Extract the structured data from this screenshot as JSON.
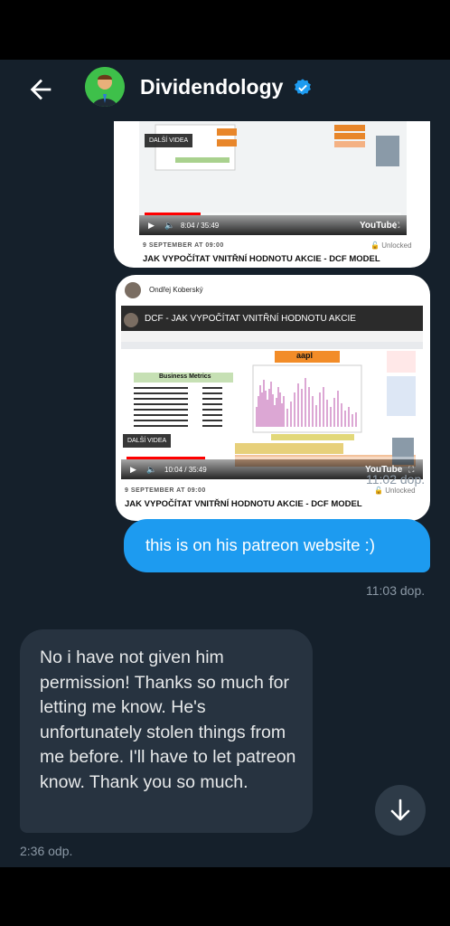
{
  "header": {
    "title": "Dividendology",
    "back_icon": "arrow-left-icon",
    "verified_icon": "verified-badge-icon"
  },
  "post_top": {
    "date": "9 SEPTEMBER AT 09:00",
    "unlocked": "Unlocked",
    "title": "JAK VYPOČÍTAT VNITŘNÍ HODNOTU AKCIE - DCF MODEL",
    "dalsi_videa": "DALŠÍ VIDEA",
    "time": "8:04 / 35:49",
    "youtube": "YouTube",
    "progress": 0.22
  },
  "post_main": {
    "author": "Ondřej Koberský",
    "video_title": "DCF - JAK VYPOČÍTAT VNITŘNÍ HODNOTU AKCIE",
    "ticker": "aapl",
    "table_title": "Business Metrics",
    "dalsi_videa": "DALŠÍ VIDEA",
    "time": "10:04 / 35:49",
    "youtube": "YouTube",
    "date": "9 SEPTEMBER AT 09:00",
    "unlocked": "Unlocked",
    "title": "JAK VYPOČÍTAT VNITŘNÍ HODNOTU AKCIE - DCF MODEL",
    "progress": 0.27
  },
  "messages": {
    "time1": "11:02 dop.",
    "outgoing": "this is on his patreon website :)",
    "time2": "11:03 dop.",
    "incoming": "No i have not given him permission! Thanks so much for letting me know. He's unfortunately stolen things from me before. I'll have to let patreon know. Thank you so much.",
    "time3": "2:36 odp."
  },
  "colors": {
    "background": "#15202b",
    "accent": "#1d9bf0",
    "incoming_bubble": "#273340"
  }
}
